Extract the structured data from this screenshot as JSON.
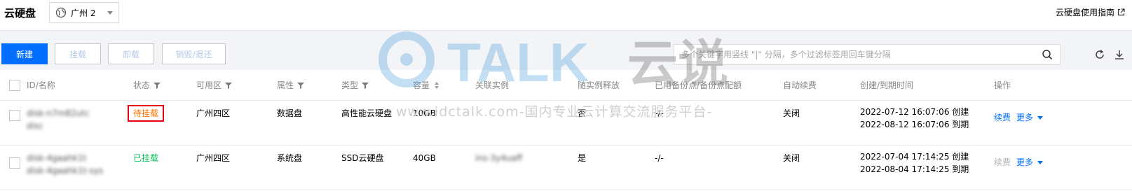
{
  "header": {
    "title": "云硬盘",
    "region": "广州 2",
    "guide_link": "云硬盘使用指南"
  },
  "toolbar": {
    "new_label": "新建",
    "mount_label": "挂载",
    "unmount_label": "卸载",
    "destroy_label": "销毁/退还",
    "search_placeholder": "多个关键字用竖线 \"|\" 分隔，多个过滤标签用回车键分隔"
  },
  "table": {
    "columns": [
      "ID/名称",
      "状态",
      "可用区",
      "属性",
      "类型",
      "容量",
      "关联实例",
      "随实例释放",
      "已用备份点/备份点配额",
      "自动续费",
      "创建/到期时间",
      "操作"
    ],
    "rows": [
      {
        "id": "disk-n7m82utc",
        "name": "disc",
        "status": "待挂载",
        "zone": "广州四区",
        "attribute": "数据盘",
        "type": "高性能云硬盘",
        "capacity": "10GB",
        "instance": "",
        "release_with_instance": "否",
        "backup": "-/-",
        "auto_renew": "关闭",
        "created": "2022-07-12 16:07:06 创建",
        "expires": "2022-08-12 16:07:06 到期",
        "action_renew": "续费",
        "action_more": "更多"
      },
      {
        "id": "disk-4gaahk1t",
        "name": "disk-4gaahk1t-sys",
        "status": "已挂载",
        "zone": "广州四区",
        "attribute": "系统盘",
        "type": "SSD云硬盘",
        "capacity": "40GB",
        "instance": "ins-3y4uaff",
        "release_with_instance": "是",
        "backup": "-/-",
        "auto_renew": "关闭",
        "created": "2022-07-04 17:14:25 创建",
        "expires": "2022-08-04 17:14:25 到期",
        "action_renew": "续费",
        "action_more": "更多"
      }
    ]
  },
  "watermark": {
    "brand": "TALK",
    "cn": "云说",
    "url": "www.idctalk.com-国内专业云计算交流服务平台-"
  },
  "colors": {
    "primary": "#006eff",
    "pending": "#ff7200",
    "mounted": "#0abf5b",
    "highlight_box": "#e60012"
  }
}
